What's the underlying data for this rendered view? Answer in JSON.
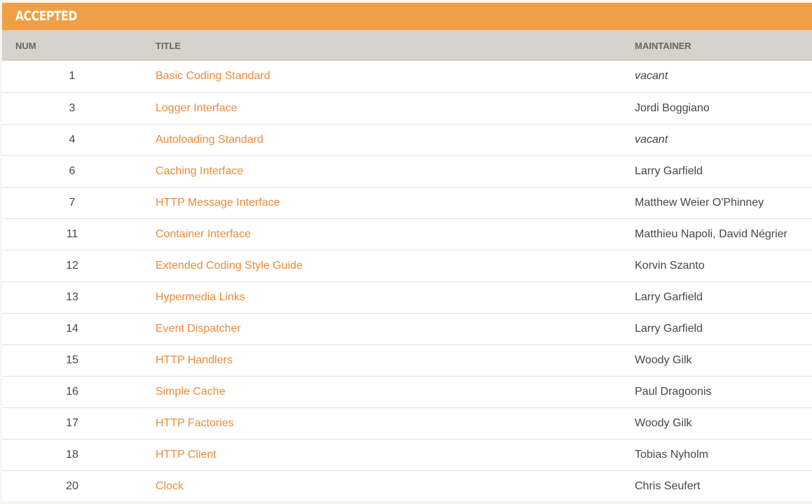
{
  "section": {
    "title": "ACCEPTED"
  },
  "table": {
    "headers": {
      "num": "NUM",
      "title": "TITLE",
      "maintainer": "MAINTAINER"
    },
    "rows": [
      {
        "num": "1",
        "title": "Basic Coding Standard",
        "maintainer": "vacant",
        "italic": true
      },
      {
        "num": "3",
        "title": "Logger Interface",
        "maintainer": "Jordi Boggiano",
        "italic": false
      },
      {
        "num": "4",
        "title": "Autoloading Standard",
        "maintainer": "vacant",
        "italic": true
      },
      {
        "num": "6",
        "title": "Caching Interface",
        "maintainer": "Larry Garfield",
        "italic": false
      },
      {
        "num": "7",
        "title": "HTTP Message Interface",
        "maintainer": "Matthew Weier O'Phinney",
        "italic": false
      },
      {
        "num": "11",
        "title": "Container Interface",
        "maintainer": "Matthieu Napoli, David Négrier",
        "italic": false
      },
      {
        "num": "12",
        "title": "Extended Coding Style Guide",
        "maintainer": "Korvin Szanto",
        "italic": false
      },
      {
        "num": "13",
        "title": "Hypermedia Links",
        "maintainer": "Larry Garfield",
        "italic": false
      },
      {
        "num": "14",
        "title": "Event Dispatcher",
        "maintainer": "Larry Garfield",
        "italic": false
      },
      {
        "num": "15",
        "title": "HTTP Handlers",
        "maintainer": "Woody Gilk",
        "italic": false
      },
      {
        "num": "16",
        "title": "Simple Cache",
        "maintainer": "Paul Dragoonis",
        "italic": false
      },
      {
        "num": "17",
        "title": "HTTP Factories",
        "maintainer": "Woody Gilk",
        "italic": false
      },
      {
        "num": "18",
        "title": "HTTP Client",
        "maintainer": "Tobias Nyholm",
        "italic": false
      },
      {
        "num": "20",
        "title": "Clock",
        "maintainer": "Chris Seufert",
        "italic": false
      }
    ]
  },
  "colors": {
    "header_bg": "#f0a044",
    "thead_bg": "#d6d1ca",
    "link": "#ec8a3a",
    "text": "#4a4640"
  }
}
